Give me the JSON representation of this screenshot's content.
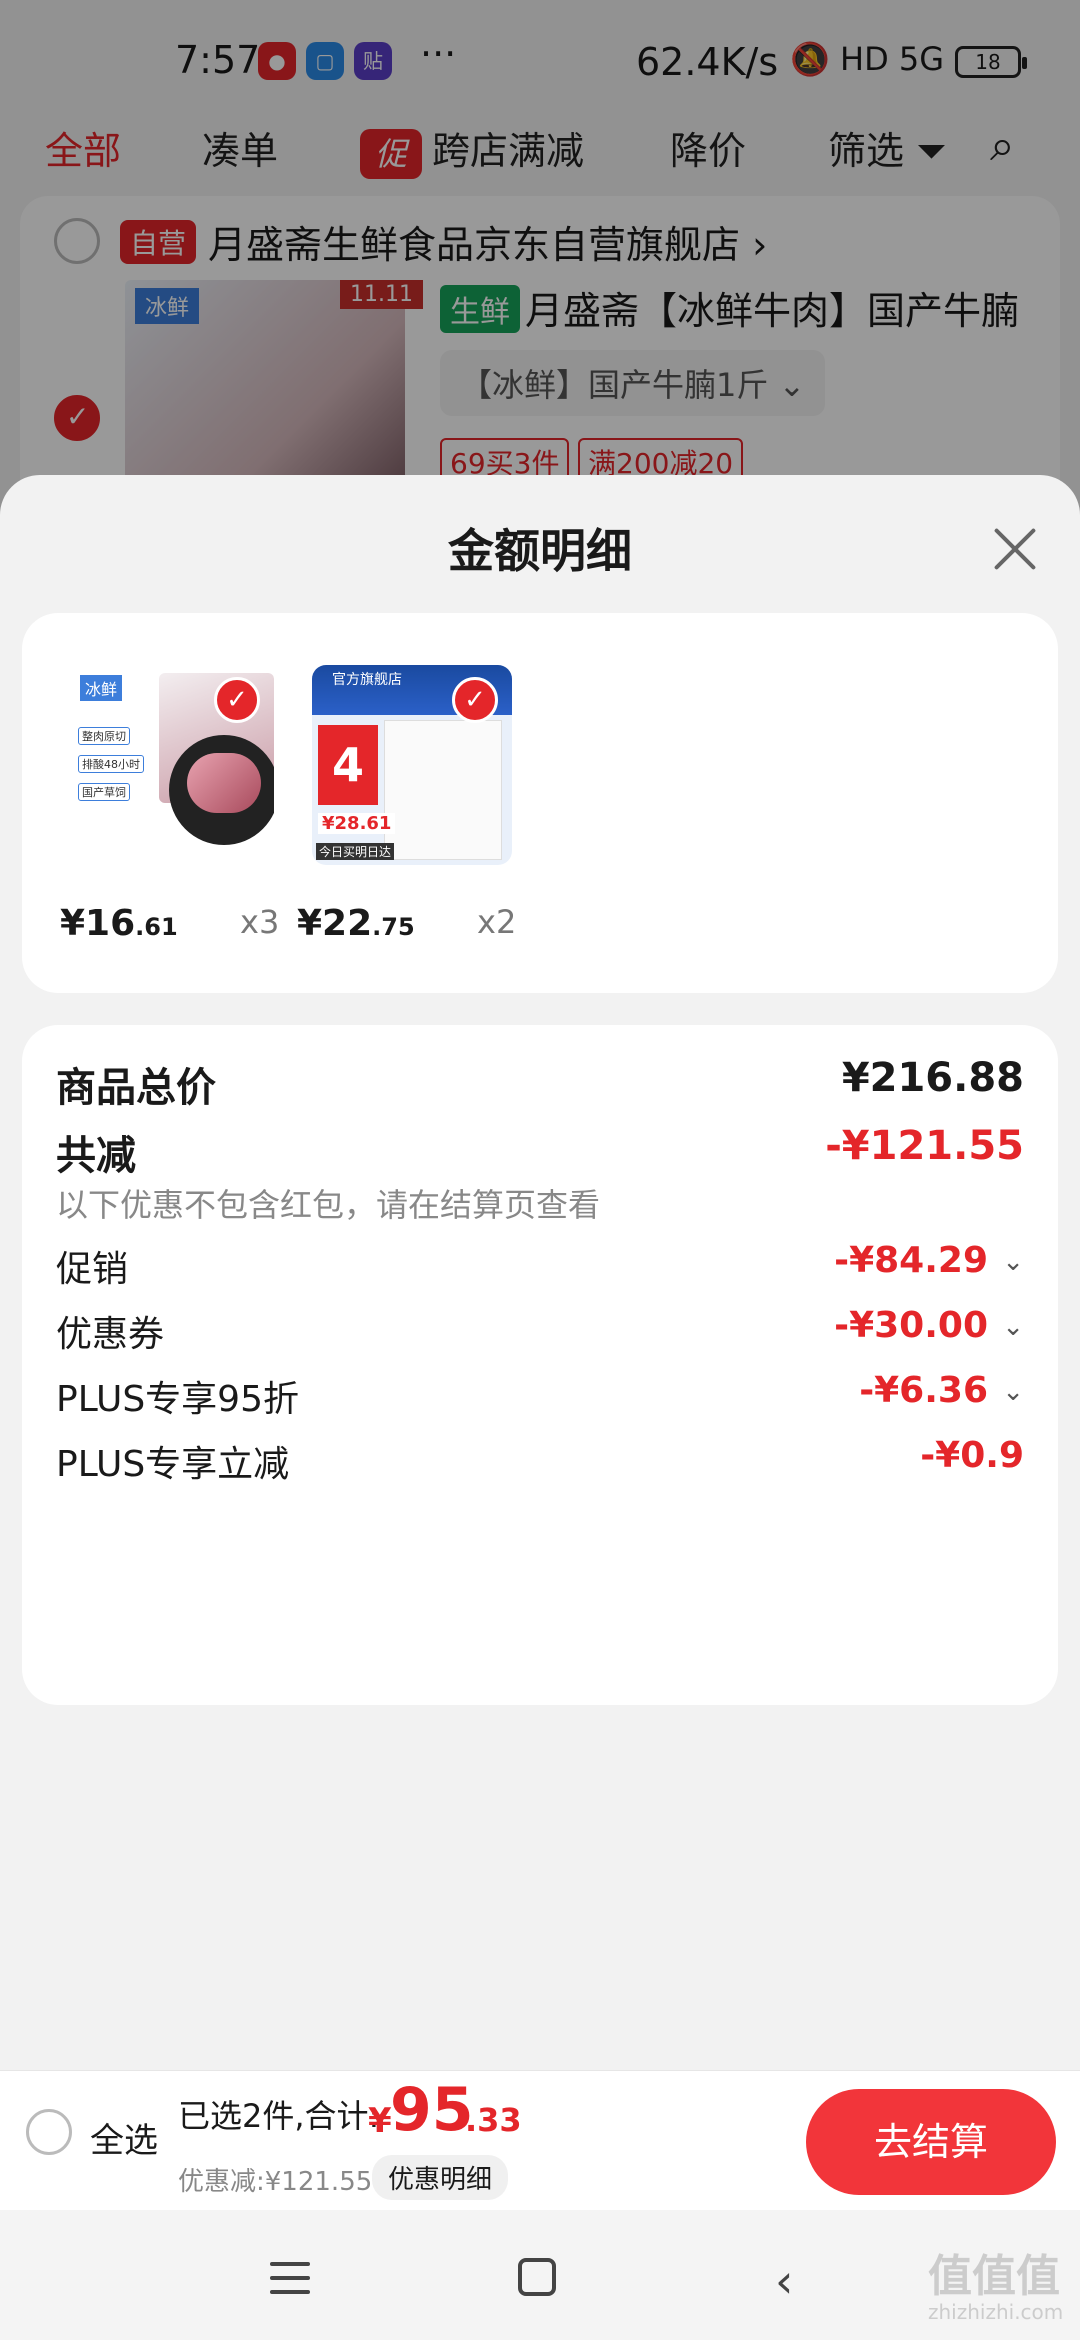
{
  "status_bar": {
    "time": "7:57",
    "dots": "···",
    "net_speed": "62.4K/s",
    "right_icons": "🔕 HD 5G",
    "battery": "18",
    "app_icons": [
      "app-icon-1",
      "app-icon-2",
      "贴"
    ]
  },
  "tabs": [
    {
      "label": "全部",
      "active": true
    },
    {
      "label": "凑单"
    },
    {
      "label": "跨店满减",
      "badge": "促"
    },
    {
      "label": "降价"
    },
    {
      "label": "筛选"
    }
  ],
  "store": {
    "badge": "自营",
    "name": "月盛斋生鲜食品京东自营旗舰店",
    "chevron": "›"
  },
  "product": {
    "image_tag": "冰鲜",
    "image_corner": "11.11",
    "category_badge": "生鲜",
    "title": "月盛斋【冰鲜牛肉】国产牛腩",
    "variant": "【冰鲜】国产牛腩1斤",
    "tags": [
      "69买3件",
      "满200减20"
    ]
  },
  "sheet": {
    "title": "金额明细",
    "items": [
      {
        "price_int": "¥16",
        "price_dec": ".61",
        "qty": "x3",
        "image": "beef-brisket",
        "thumb_label": "冰鲜",
        "thumb_checks": [
          "整肉原切",
          "排酸48小时",
          "国产草饲"
        ]
      },
      {
        "price_int": "¥22",
        "price_dec": ".75",
        "qty": "x2",
        "image": "schneider-panel",
        "thumb_top": "官方旗舰店",
        "thumb_big": "4",
        "thumb_price": "¥28.61",
        "thumb_bottom": "今日买明日达"
      }
    ],
    "total_label": "商品总价",
    "total_value": "¥216.88",
    "discount_label": "共减",
    "discount_value": "-¥121.55",
    "discount_note": "以下优惠不包含红包，请在结算页查看",
    "discount_rows": [
      {
        "label": "促销",
        "value": "-¥84.29",
        "expandable": true
      },
      {
        "label": "优惠券",
        "value": "-¥30.00",
        "expandable": true
      },
      {
        "label": "PLUS专享95折",
        "value": "-¥6.36",
        "expandable": true
      },
      {
        "label": "PLUS专享立减",
        "value": "-¥0.9",
        "expandable": false
      }
    ]
  },
  "bottom_bar": {
    "select_all": "全选",
    "summary_prefix": "已选2件,合计:",
    "currency": "¥",
    "amount_int": "95",
    "amount_dec": ".33",
    "discount_text": "优惠减:¥121.55",
    "detail_pill": "优惠明细",
    "checkout": "去结算"
  },
  "watermark": {
    "text": "值值值",
    "sub": "zhizhizhi.com"
  },
  "colors": {
    "accent": "#e4262a",
    "checkout": "#f2353a",
    "fresh": "#17a35a",
    "tag_blue": "#3d7edb"
  }
}
